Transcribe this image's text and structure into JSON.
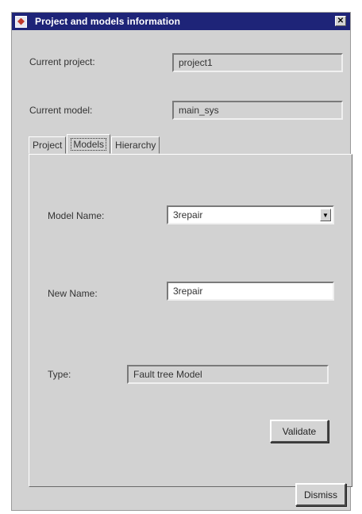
{
  "window": {
    "title": "Project and models information",
    "close_glyph": "✕"
  },
  "project_info": {
    "current_project_label": "Current project:",
    "current_project_value": "project1",
    "current_model_label": "Current model:",
    "current_model_value": "main_sys"
  },
  "tabs": [
    {
      "label": "Project",
      "selected": false
    },
    {
      "label": "Models",
      "selected": true
    },
    {
      "label": "Hierarchy",
      "selected": false
    }
  ],
  "models_tab": {
    "model_name_label": "Model Name:",
    "model_name_value": "3repair",
    "dropdown_glyph": "▼",
    "new_name_label": "New Name:",
    "new_name_value": "3repair",
    "type_label": "Type:",
    "type_value": "Fault tree Model",
    "validate_label": "Validate"
  },
  "footer": {
    "dismiss_label": "Dismiss"
  },
  "colors": {
    "titlebar": "#1e2478",
    "window_bg": "#d2d2d2"
  }
}
